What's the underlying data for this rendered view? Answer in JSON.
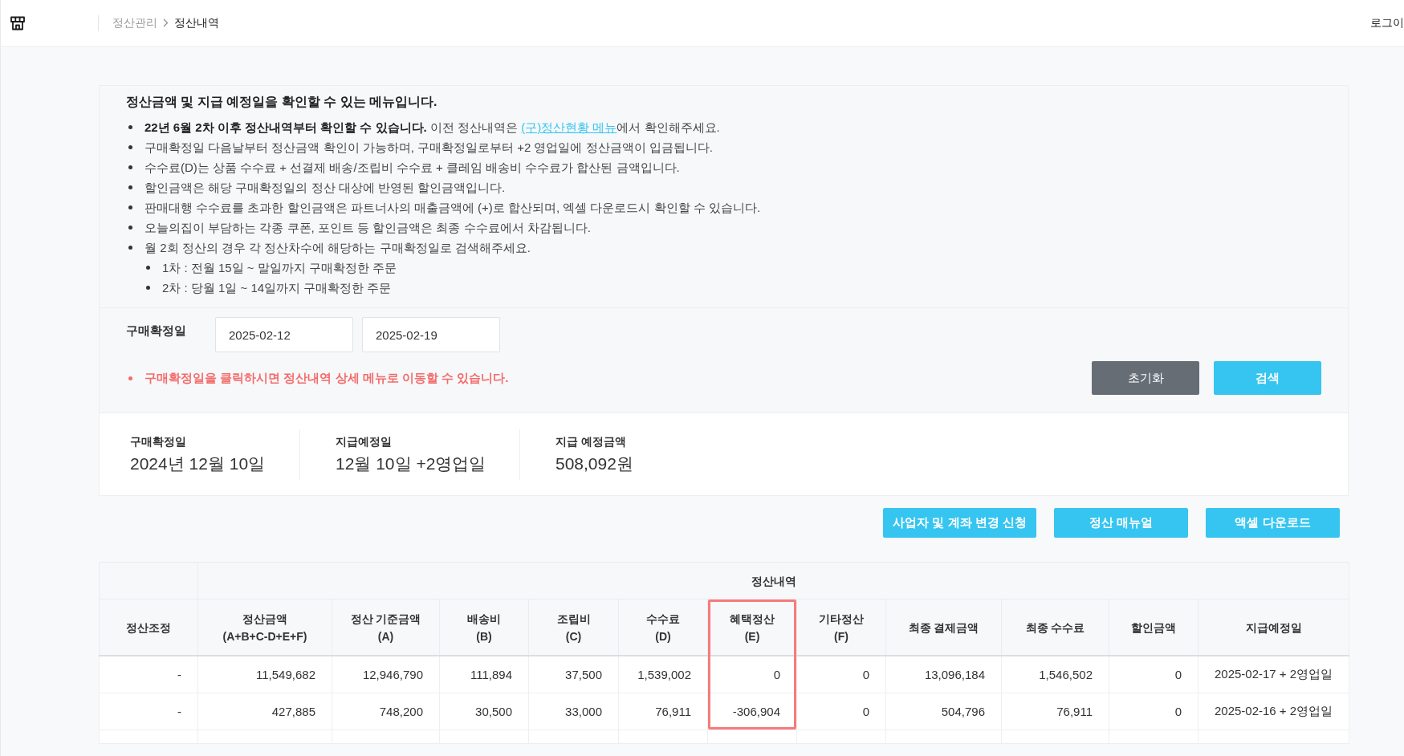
{
  "header": {
    "breadcrumb": [
      {
        "label": "정산관리",
        "current": false
      },
      {
        "label": "정산내역",
        "current": true
      }
    ],
    "login": "로그이"
  },
  "notice": {
    "title": "정산금액 및 지급 예정일을 확인할 수 있는 메뉴입니다.",
    "items": [
      {
        "text": "**22년 6월 2차 이후 정산내역부터 확인할 수 있습니다.** 이전 정산내역은 ",
        "link": "(구)정산현황 메뉴",
        "text_after": "에서 확인해주세요."
      },
      {
        "text": "구매확정일 다음날부터 정산금액 확인이 가능하며, 구매확정일로부터 +2 영업일에 정산금액이 입금됩니다."
      },
      {
        "text": "수수료(D)는 상품 수수료 + 선결제 배송/조립비 수수료 + 클레임 배송비 수수료가 합산된 금액입니다."
      },
      {
        "text": "할인금액은 해당 구매확정일의 정산 대상에 반영된 할인금액입니다."
      },
      {
        "text": "판매대행 수수료를 초과한 할인금액은 파트너사의 매출금액에 (+)로 합산되며, 엑셀 다운로드시 확인할 수 있습니다."
      },
      {
        "text": "오늘의집이 부담하는 각종 쿠폰, 포인트 등 할인금액은 최종 수수료에서 차감됩니다."
      },
      {
        "text": "월 2회 정산의 경우 각 정산차수에 해당하는 구매확정일로 검색해주세요.",
        "children": [
          {
            "text": "1차 : 전월 15일 ~ 말일까지 구매확정한 주문"
          },
          {
            "text": "2차 : 당월 1일 ~ 14일까지 구매확정한 주문"
          }
        ]
      }
    ]
  },
  "filter": {
    "label": "구매확정일",
    "start_date": "2025-02-12",
    "end_date": "2025-02-19",
    "note": "구매확정일을 클릭하시면 정산내역 상세 메뉴로 이동할 수 있습니다.",
    "buttons": [
      {
        "label": "초기화",
        "kind": "secondary"
      },
      {
        "label": "검색",
        "kind": "primary"
      }
    ]
  },
  "summary": [
    {
      "label": "구매확정일",
      "value": "2024년 12월 10일"
    },
    {
      "label": "지급예정일",
      "value": "12월 10일 +2영업일"
    },
    {
      "label": "지급 예정금액",
      "value": "508,092원"
    }
  ],
  "actions": [
    "사업자 및 계좌 변경 신청",
    "정산 매뉴얼",
    "액셀 다운로드"
  ],
  "table": {
    "group_header": "정산내역",
    "columns": [
      {
        "label": "정산조정",
        "highlighted": false
      },
      {
        "label": "정산금액",
        "sublabel": "(A+B+C-D+E+F)",
        "highlighted": false
      },
      {
        "label": "정산 기준금액",
        "sublabel": "(A)",
        "highlighted": false
      },
      {
        "label": "배송비",
        "sublabel": "(B)",
        "highlighted": false
      },
      {
        "label": "조립비",
        "sublabel": "(C)",
        "highlighted": false
      },
      {
        "label": "수수료",
        "sublabel": "(D)",
        "highlighted": false
      },
      {
        "label": "혜택정산",
        "sublabel": "(E)",
        "highlighted": true
      },
      {
        "label": "기타정산",
        "sublabel": "(F)",
        "highlighted": false
      },
      {
        "label": "최종 결제금액",
        "highlighted": false
      },
      {
        "label": "최종 수수료",
        "highlighted": false
      },
      {
        "label": "할인금액",
        "highlighted": false
      },
      {
        "label": "지급예정일",
        "highlighted": false
      }
    ],
    "rows": [
      [
        "-",
        "11,549,682",
        "12,946,790",
        "111,894",
        "37,500",
        "1,539,002",
        "0",
        "0",
        "13,096,184",
        "1,546,502",
        "0",
        "2025-02-17 + 2영업일"
      ],
      [
        "-",
        "427,885",
        "748,200",
        "30,500",
        "33,000",
        "76,911",
        "-306,904",
        "0",
        "504,796",
        "76,911",
        "0",
        "2025-02-16 + 2영업일"
      ]
    ]
  }
}
